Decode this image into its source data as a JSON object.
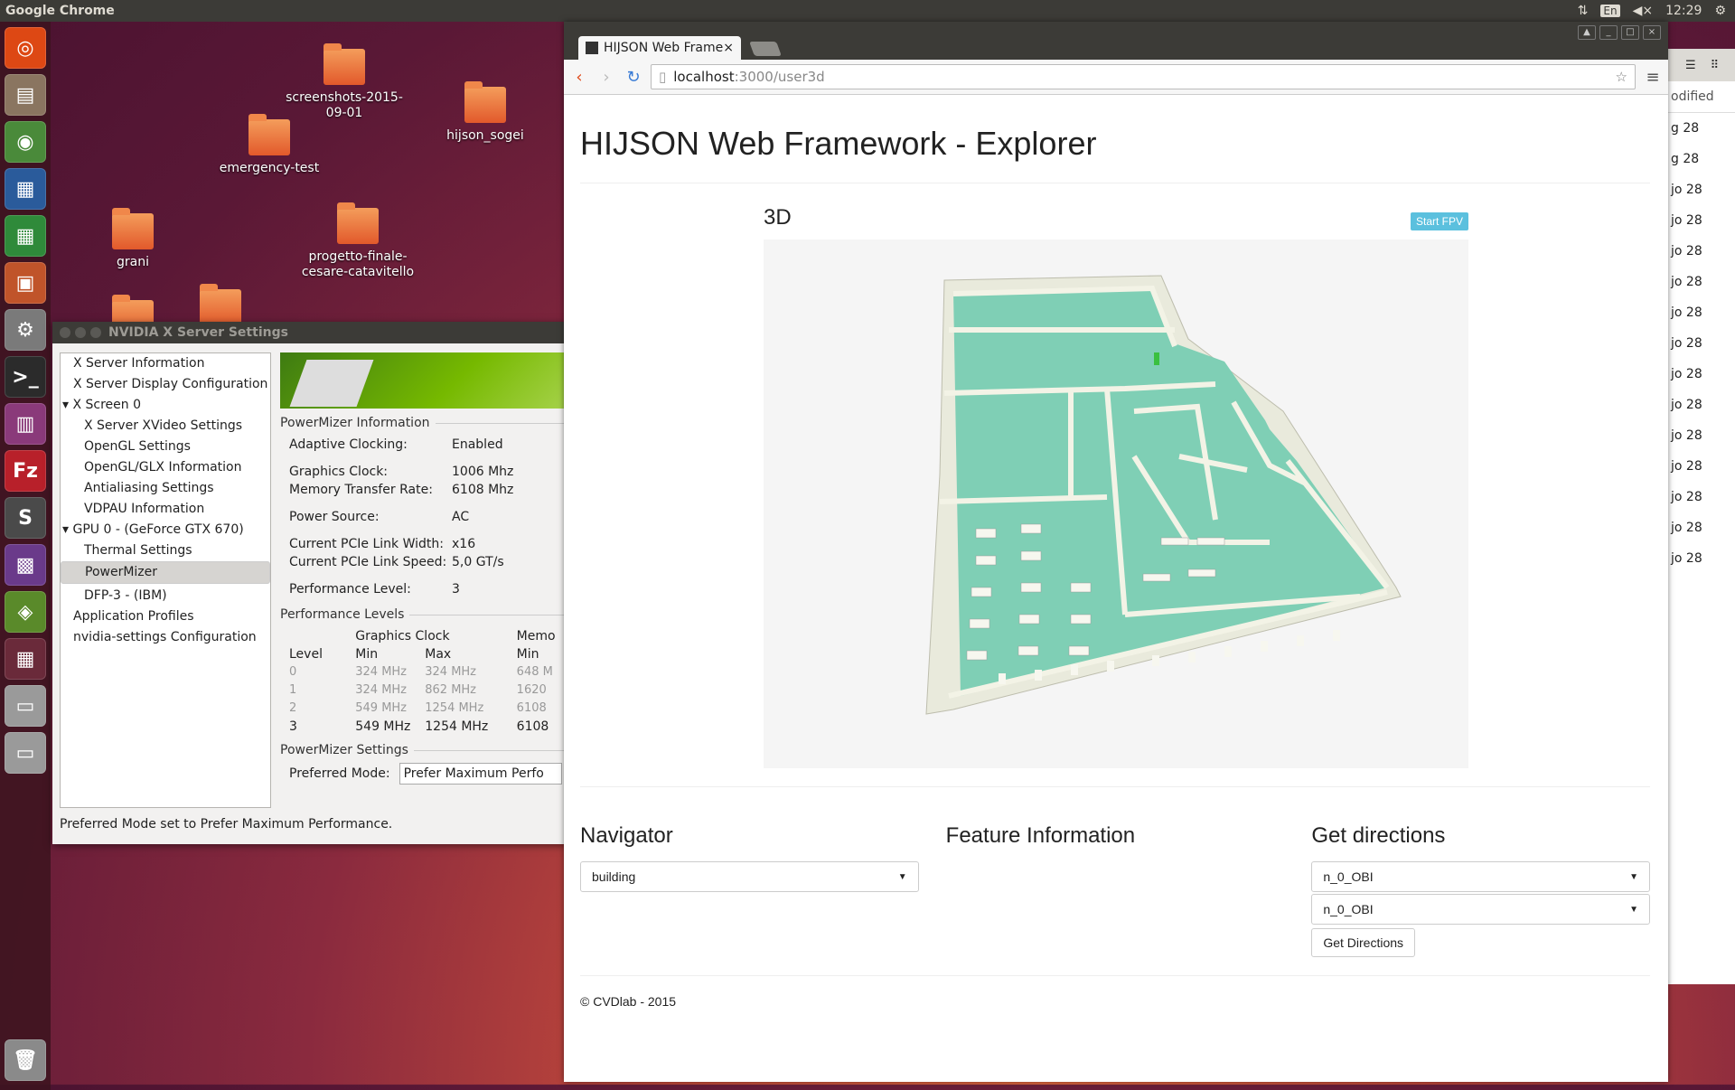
{
  "topbar": {
    "app_name": "Google Chrome",
    "keyboard": "En",
    "time": "12:29"
  },
  "desktop": {
    "icons": [
      {
        "label": "screenshots-2015-09-01"
      },
      {
        "label": "hijson_sogei"
      },
      {
        "label": "emergency-test"
      },
      {
        "label": "grani"
      },
      {
        "label": "progetto-finale-cesare-catavitello"
      }
    ]
  },
  "nvidia": {
    "title": "NVIDIA X Server Settings",
    "tree": [
      "X Server Information",
      "X Server Display Configuration",
      "X Screen 0",
      "X Server XVideo Settings",
      "OpenGL Settings",
      "OpenGL/GLX Information",
      "Antialiasing Settings",
      "VDPAU Information",
      "GPU 0 - (GeForce GTX 670)",
      "Thermal Settings",
      "PowerMizer",
      "DFP-3 - (IBM)",
      "Application Profiles",
      "nvidia-settings Configuration"
    ],
    "info_title": "PowerMizer Information",
    "info": [
      {
        "k": "Adaptive Clocking:",
        "v": "Enabled"
      },
      {
        "k": "Graphics Clock:",
        "v": "1006 Mhz"
      },
      {
        "k": "Memory Transfer Rate:",
        "v": "6108 Mhz"
      },
      {
        "k": "Power Source:",
        "v": "AC"
      },
      {
        "k": "Current PCIe Link Width:",
        "v": "x16"
      },
      {
        "k": "Current PCIe Link Speed:",
        "v": "5,0 GT/s"
      },
      {
        "k": "Performance Level:",
        "v": "3"
      }
    ],
    "levels_title": "Performance Levels",
    "levels_header": {
      "graphics": "Graphics Clock",
      "memory": "Memo",
      "level": "Level",
      "min": "Min",
      "max": "Max",
      "mem_min": "Min"
    },
    "levels": [
      {
        "level": "0",
        "min": "324 MHz",
        "max": "324 MHz",
        "mem": "648 M"
      },
      {
        "level": "1",
        "min": "324 MHz",
        "max": "862 MHz",
        "mem": "1620"
      },
      {
        "level": "2",
        "min": "549 MHz",
        "max": "1254 MHz",
        "mem": "6108"
      },
      {
        "level": "3",
        "min": "549 MHz",
        "max": "1254 MHz",
        "mem": "6108"
      }
    ],
    "settings_title": "PowerMizer Settings",
    "preferred_label": "Preferred Mode:",
    "preferred_value": "Prefer Maximum Perfo",
    "status": "Preferred Mode set to Prefer Maximum Performance."
  },
  "filemanager": {
    "header": "odified",
    "rows": [
      "g 28",
      "g 28",
      "jo 28",
      "jo 28",
      "jo 28",
      "jo 28",
      "jo 28",
      "jo 28",
      "jo 28",
      "jo 28",
      "jo 28",
      "jo 28",
      "jo 28",
      "jo 28",
      "jo 28"
    ]
  },
  "chrome": {
    "tab_title": "HIJSON Web Framew",
    "url_host": "localhost",
    "url_path": ":3000/user3d"
  },
  "page": {
    "title": "HIJSON Web Framework - Explorer",
    "panel_title": "3D",
    "fpv_button": "Start FPV",
    "navigator_title": "Navigator",
    "navigator_value": "building",
    "feature_title": "Feature Information",
    "directions_title": "Get directions",
    "from_value": "n_0_OBI",
    "to_value": "n_0_OBI",
    "directions_button": "Get Directions",
    "footer": "© CVDlab - 2015"
  }
}
